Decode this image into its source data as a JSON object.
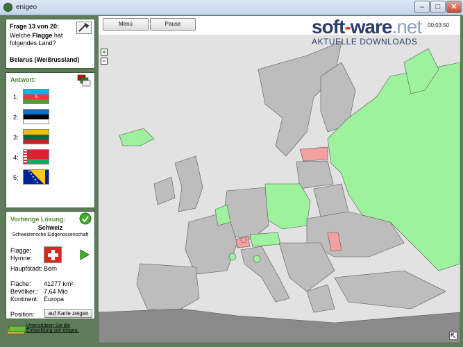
{
  "window": {
    "title": "enigeo",
    "minimize": "–",
    "maximize": "□",
    "close": "✕"
  },
  "question": {
    "counter": "Frage 13 von 20:",
    "line1_pre": "Welche ",
    "line1_bold": "Flagge",
    "line1_post": " hat",
    "line2": "folgendes Land?",
    "country": "Belarus (Weißrussland)"
  },
  "answers": {
    "heading": "Antwort:",
    "items": [
      {
        "num": "1:",
        "flag": "Azerbaijan"
      },
      {
        "num": "2:",
        "flag": "Estonia"
      },
      {
        "num": "3:",
        "flag": "Lithuania"
      },
      {
        "num": "4:",
        "flag": "Belarus"
      },
      {
        "num": "5:",
        "flag": "Bosnia and Herzegovina"
      }
    ]
  },
  "previous": {
    "heading": "Vorherige Lösung:",
    "country": "Schweiz",
    "official": "Schweizerische Eidgenossenschaft",
    "flag_label": "Flagge:",
    "anthem_label": "Hymne:",
    "capital_label": "Hauptstadt:",
    "capital": "Bern",
    "area_label": "Fläche:",
    "area": "41277 km²",
    "population_label": "Bevölker.:",
    "population": "7,64 Mio",
    "continent_label": "Kontinent:",
    "continent": "Europa",
    "position_label": "Position:",
    "show_map_button": "auf Karte zeigen"
  },
  "support": {
    "line1": "Unterstützen Sie die",
    "line2": "Entwicklung von enigeo."
  },
  "toolbar": {
    "menu": "Menü",
    "pause": "Pause",
    "timer": "00:03:50"
  },
  "watermark": {
    "brand_part1": "soft",
    "brand_dash": "-",
    "brand_part2": "ware",
    "brand_tld": ".net",
    "tagline": "AKTUELLE DOWNLOADS"
  },
  "zoom": {
    "in": "+",
    "out": "−"
  },
  "colors": {
    "frame": "#5e7b5a",
    "panel_border": "#3d5a3a",
    "heading_green": "#4e8a2c",
    "sea": "#ffffff",
    "land": "#bdbdbd",
    "land_dark": "#8a8a8a",
    "highlight_green": "#9ef29e",
    "highlight_red": "#f2a0a0"
  }
}
